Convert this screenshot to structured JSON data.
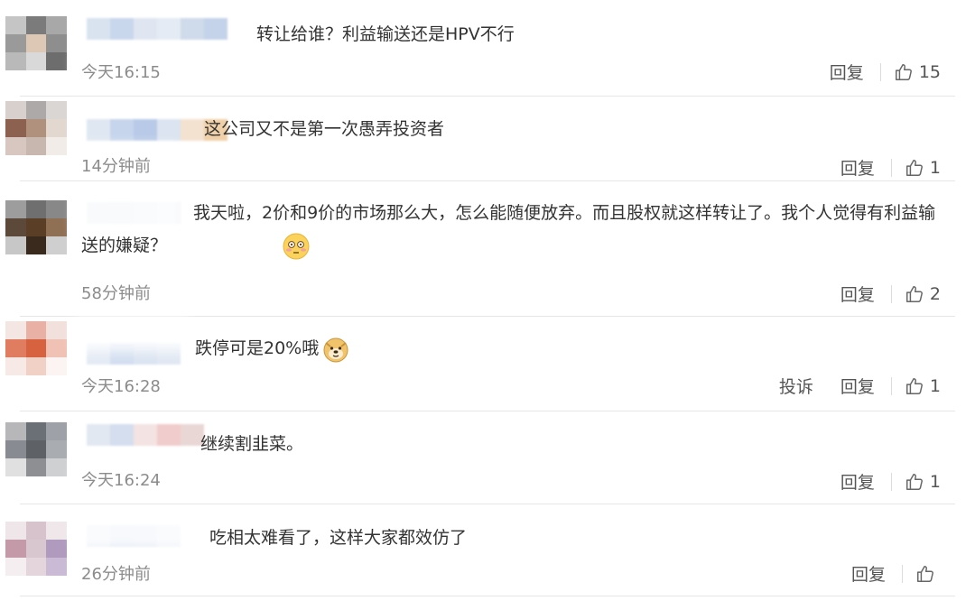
{
  "colors": {
    "divider": "#e6e6e6",
    "time": "#8c8c8c",
    "text": "#333333"
  },
  "comments": [
    {
      "text": "转让给谁？利益输送还是HPV不行",
      "time": "今天16:15",
      "actions": [
        "回复"
      ],
      "likes": "15",
      "avatar": [
        "#c5c5c5",
        "#7b7b7b",
        "#a8a8a8",
        "#9a9a9a",
        "#ddc7b5",
        "#8e8e8e",
        "#b9b9b9",
        "#d9d9d9",
        "#6d6d6d"
      ],
      "name_colors": [
        "#d9e3f0",
        "#c9d7ec",
        "#dfe6f1",
        "#e4ebf4",
        "#cfdaea",
        "#c4d3ea"
      ]
    },
    {
      "text": "这公司又不是第一次愚弄投资者",
      "time": "14分钟前",
      "actions": [
        "回复"
      ],
      "likes": "1",
      "avatar": [
        "#d8d0cc",
        "#aca9a8",
        "#d9d6d4",
        "#8c6150",
        "#b0917d",
        "#e3d8d0",
        "#d8c7c0",
        "#c7b7ae",
        "#f1ece8"
      ],
      "name_colors": [
        "#dfe7f2",
        "#c6d5ec",
        "#b8cae8",
        "#dbe4f0",
        "#f3e2cf",
        "#f0d0a8"
      ]
    },
    {
      "text": "我天啦，2价和9价的市场那么大，怎么能随便放弃。而且股权就这样转让了。我个人觉得有利益输送的嫌疑？",
      "time": "58分钟前",
      "actions": [
        "回复"
      ],
      "likes": "2",
      "emoji": "flushed-emoji",
      "avatar": [
        "#9d9d9d",
        "#6f6f6f",
        "#888888",
        "#5d4939",
        "#5b3e26",
        "#8f7055",
        "#c7c7c7",
        "#3a2a1e",
        "#d0cfcf"
      ],
      "name_colors": [
        "#e4e9f2",
        "#dfe6f1",
        "#e7ecf4",
        "#eef1f6"
      ]
    },
    {
      "text": "跌停可是20%哦",
      "time": "今天16:28",
      "actions": [
        "投诉",
        "回复"
      ],
      "likes": "1",
      "emoji": "doge-emoji",
      "avatar": [
        "#f3e6e3",
        "#e9b1a6",
        "#f2e0dc",
        "#e07c60",
        "#d6623f",
        "#f0c2b6",
        "#f6e9e6",
        "#f1d0c6",
        "#fbf4f2"
      ],
      "name_colors": [
        "#e4ebf5",
        "#d3def0",
        "#dbe4f2",
        "#e1e8f3"
      ]
    },
    {
      "text": "继续割韭菜。",
      "time": "今天16:24",
      "actions": [
        "回复"
      ],
      "likes": "1",
      "avatar": [
        "#b7b7b9",
        "#6b7077",
        "#9ea2a8",
        "#888c92",
        "#5e6166",
        "#a9acb0",
        "#e0e0e1",
        "#8d8f93",
        "#cfd0d2"
      ],
      "name_colors": [
        "#e2e8f1",
        "#d4deee",
        "#f3e3e2",
        "#f0cccc",
        "#e9d7d6"
      ]
    },
    {
      "text": "吃相太难看了，这样大家都效仿了",
      "time": "26分钟前",
      "actions": [
        "回复"
      ],
      "likes": "",
      "avatar": [
        "#eee6e9",
        "#d6c3cc",
        "#efe7ea",
        "#c59aa8",
        "#d9c7cf",
        "#b09bbf",
        "#f4eef1",
        "#e4d4db",
        "#cbbad6"
      ],
      "name_colors": [
        "#e6ecf5",
        "#d9e3f2",
        "#dce5f2",
        "#e8edf5"
      ]
    }
  ]
}
